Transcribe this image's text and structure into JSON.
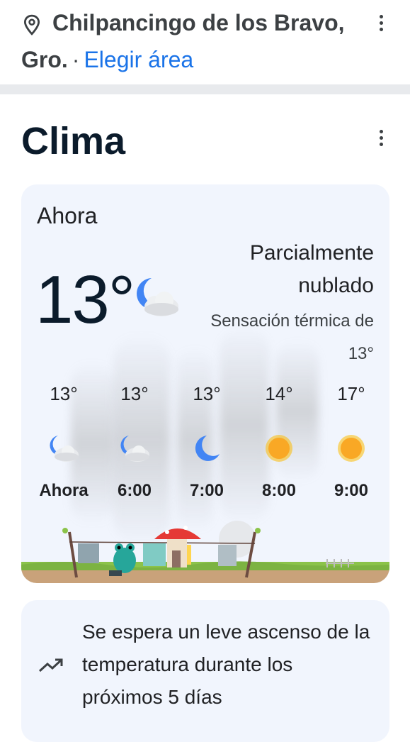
{
  "location": {
    "line1": "Chilpancingo de los Bravo,",
    "line2": "Gro.",
    "separator": "·",
    "choose_area": "Elegir área",
    "pin_icon": "location-pin-icon",
    "menu_icon": "more-vert-icon"
  },
  "weather": {
    "title": "Clima",
    "menu_icon": "more-vert-icon",
    "now_label": "Ahora",
    "temperature": "13°",
    "condition": "Parcialmente nublado",
    "feels_like": "Sensación térmica de 13°",
    "current_icon": "partly-cloudy-night-icon",
    "hourly": [
      {
        "temp": "13°",
        "icon": "partly-cloudy-night-icon",
        "label": "Ahora"
      },
      {
        "temp": "13°",
        "icon": "partly-cloudy-night-icon",
        "label": "6:00"
      },
      {
        "temp": "13°",
        "icon": "moon-icon",
        "label": "7:00"
      },
      {
        "temp": "14°",
        "icon": "sun-icon",
        "label": "8:00"
      },
      {
        "temp": "17°",
        "icon": "sun-icon",
        "label": "9:00"
      }
    ]
  },
  "trend": {
    "icon": "trending-up-icon",
    "text": "Se espera un leve ascenso de la temperatura durante los próximos 5 días"
  },
  "colors": {
    "link": "#1a73e8",
    "card_bg": "#f1f5fd",
    "sun": "#f9a825",
    "moon": "#4285f4"
  }
}
